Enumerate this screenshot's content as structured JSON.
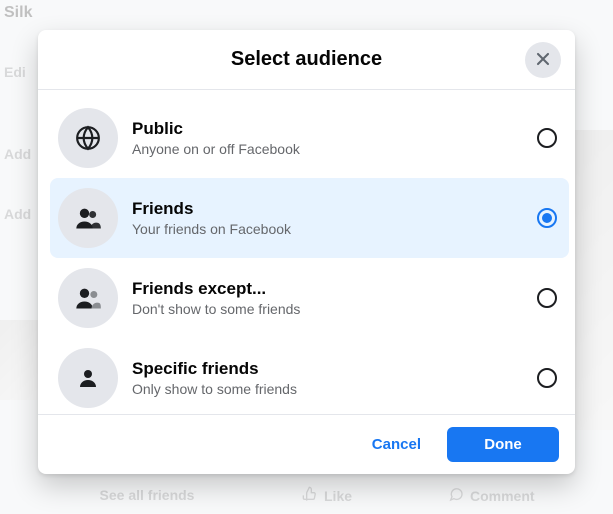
{
  "bg": {
    "name_fragment": "Silk",
    "edit": "Edi",
    "add1": "Add",
    "add2": "Add",
    "see_all": "See all friends",
    "like": "Like",
    "comment": "Comment"
  },
  "modal": {
    "title": "Select audience",
    "options": [
      {
        "id": "public",
        "title": "Public",
        "desc": "Anyone on or off Facebook",
        "selected": false,
        "icon": "globe"
      },
      {
        "id": "friends",
        "title": "Friends",
        "desc": "Your friends on Facebook",
        "selected": true,
        "icon": "friends"
      },
      {
        "id": "friends_except",
        "title": "Friends except...",
        "desc": "Don't show to some friends",
        "selected": false,
        "icon": "friends-except"
      },
      {
        "id": "specific",
        "title": "Specific friends",
        "desc": "Only show to some friends",
        "selected": false,
        "icon": "person"
      }
    ],
    "cancel": "Cancel",
    "done": "Done"
  },
  "colors": {
    "accent": "#1877f2"
  }
}
